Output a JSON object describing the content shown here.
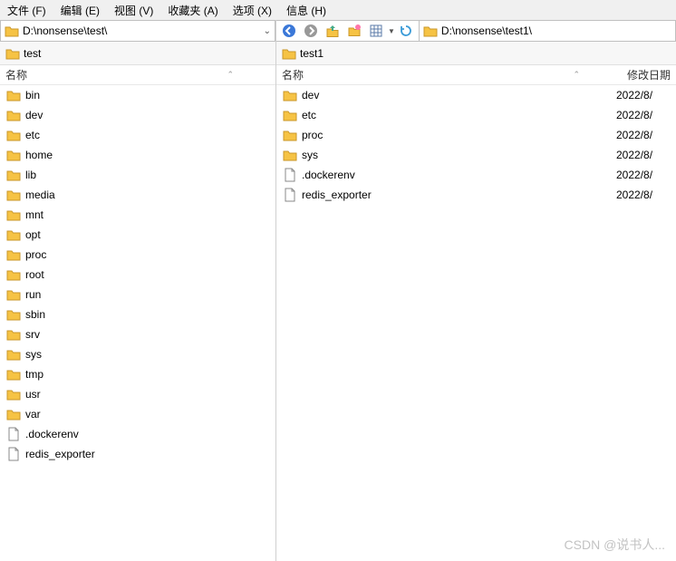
{
  "menu": {
    "file": "文件 (F)",
    "edit": "编辑 (E)",
    "view": "视图 (V)",
    "favorites": "收藏夹 (A)",
    "options": "选项 (X)",
    "info": "信息 (H)"
  },
  "left": {
    "path": "D:\\nonsense\\test\\",
    "crumb": "test",
    "columns": {
      "name": "名称"
    },
    "items": [
      {
        "name": "bin",
        "type": "folder"
      },
      {
        "name": "dev",
        "type": "folder"
      },
      {
        "name": "etc",
        "type": "folder"
      },
      {
        "name": "home",
        "type": "folder"
      },
      {
        "name": "lib",
        "type": "folder"
      },
      {
        "name": "media",
        "type": "folder"
      },
      {
        "name": "mnt",
        "type": "folder"
      },
      {
        "name": "opt",
        "type": "folder"
      },
      {
        "name": "proc",
        "type": "folder"
      },
      {
        "name": "root",
        "type": "folder"
      },
      {
        "name": "run",
        "type": "folder"
      },
      {
        "name": "sbin",
        "type": "folder"
      },
      {
        "name": "srv",
        "type": "folder"
      },
      {
        "name": "sys",
        "type": "folder"
      },
      {
        "name": "tmp",
        "type": "folder"
      },
      {
        "name": "usr",
        "type": "folder"
      },
      {
        "name": "var",
        "type": "folder"
      },
      {
        "name": ".dockerenv",
        "type": "file"
      },
      {
        "name": "redis_exporter",
        "type": "file"
      }
    ]
  },
  "right": {
    "path": "D:\\nonsense\\test1\\",
    "crumb": "test1",
    "columns": {
      "name": "名称",
      "date": "修改日期"
    },
    "items": [
      {
        "name": "dev",
        "type": "folder",
        "date": "2022/8/"
      },
      {
        "name": "etc",
        "type": "folder",
        "date": "2022/8/"
      },
      {
        "name": "proc",
        "type": "folder",
        "date": "2022/8/"
      },
      {
        "name": "sys",
        "type": "folder",
        "date": "2022/8/"
      },
      {
        "name": ".dockerenv",
        "type": "file",
        "date": "2022/8/"
      },
      {
        "name": "redis_exporter",
        "type": "file",
        "date": "2022/8/"
      }
    ]
  },
  "watermark": "CSDN @说书人..."
}
